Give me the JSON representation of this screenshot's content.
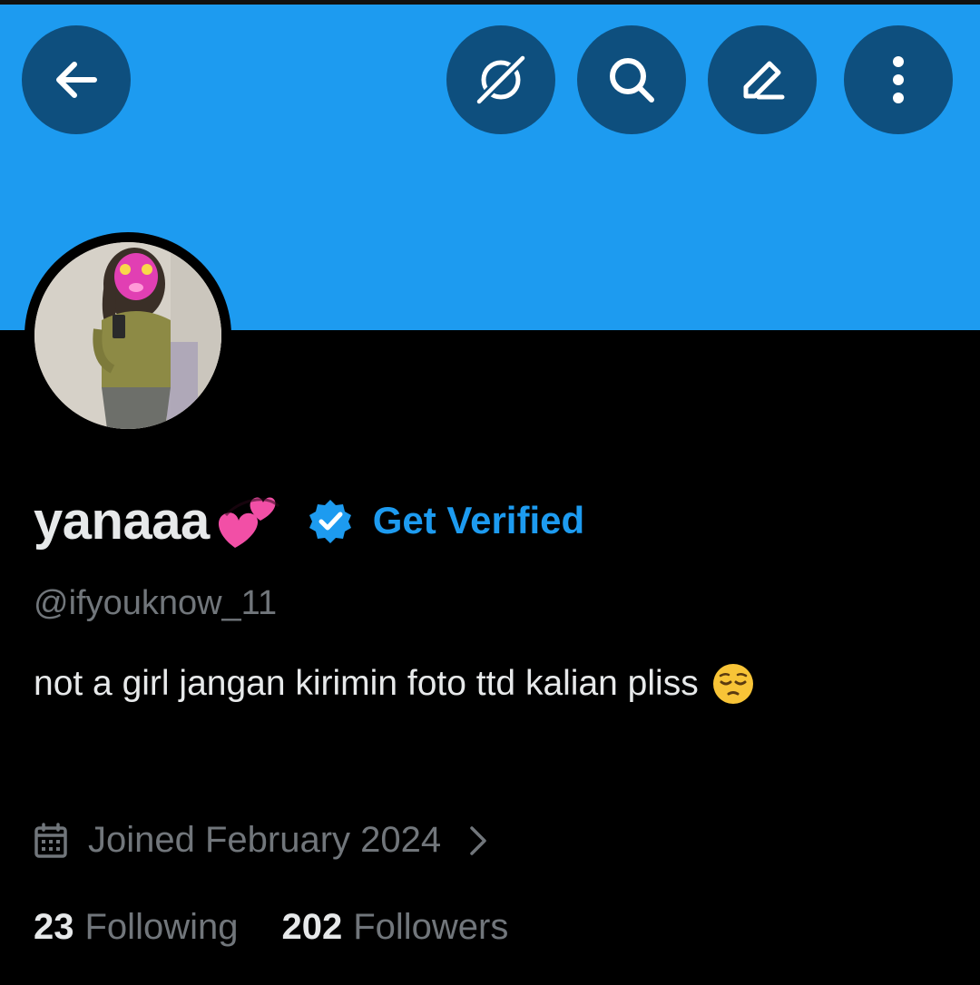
{
  "header": {
    "back_icon": "back-arrow-icon",
    "actions": [
      {
        "name": "grok-icon"
      },
      {
        "name": "search-icon"
      },
      {
        "name": "edit-icon"
      },
      {
        "name": "more-icon"
      }
    ],
    "banner_color": "#1d9bf0",
    "button_color": "#0e4f7e"
  },
  "profile": {
    "display_name": "yanaaa",
    "name_emoji": "two-hearts-emoji",
    "verified_icon": "verified-badge-icon",
    "get_verified_label": "Get Verified",
    "handle": "@ifyouknow_11",
    "bio": "not a girl jangan kirimin foto ttd kalian pliss",
    "bio_emoji": "pensive-face-emoji",
    "joined": "Joined February 2024",
    "following_count": "23",
    "following_label": "Following",
    "followers_count": "202",
    "followers_label": "Followers"
  },
  "colors": {
    "accent": "#1d9bf0",
    "text_primary": "#e7e9ea",
    "text_secondary": "#71767b",
    "background": "#000000"
  }
}
